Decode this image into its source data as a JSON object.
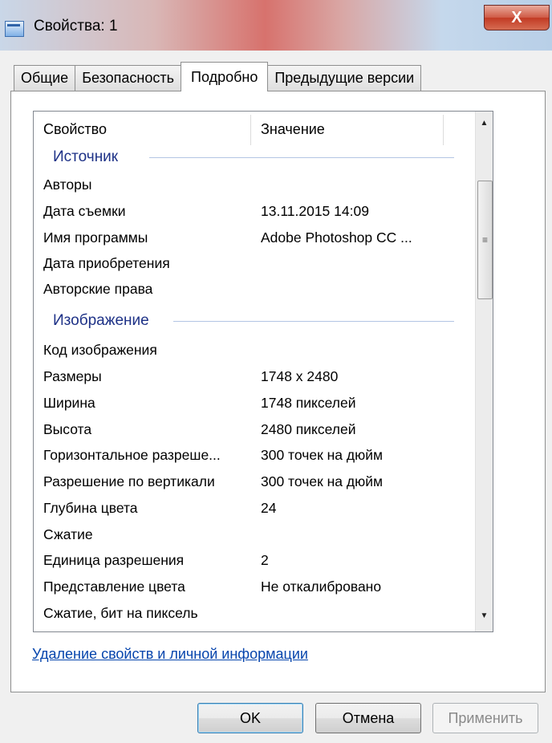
{
  "window": {
    "title": "Свойства: 1",
    "close_symbol": "X"
  },
  "tabs": [
    {
      "label": "Общие",
      "active": false
    },
    {
      "label": "Безопасность",
      "active": false
    },
    {
      "label": "Подробно",
      "active": true
    },
    {
      "label": "Предыдущие версии",
      "active": false
    }
  ],
  "grid": {
    "headers": {
      "property": "Свойство",
      "value": "Значение"
    },
    "groups": {
      "source": "Источник",
      "image": "Изображение"
    },
    "source_rows": [
      {
        "property": "Авторы",
        "value": ""
      },
      {
        "property": "Дата съемки",
        "value": "13.11.2015 14:09"
      },
      {
        "property": "Имя программы",
        "value": "Adobe Photoshop CC ..."
      },
      {
        "property": "Дата приобретения",
        "value": ""
      },
      {
        "property": "Авторские права",
        "value": ""
      }
    ],
    "image_rows": [
      {
        "property": "Код изображения",
        "value": ""
      },
      {
        "property": "Размеры",
        "value": "1748 x 2480"
      },
      {
        "property": "Ширина",
        "value": "1748 пикселей"
      },
      {
        "property": "Высота",
        "value": "2480 пикселей"
      },
      {
        "property": "Горизонтальное разреше...",
        "value": "300 точек на дюйм"
      },
      {
        "property": "Разрешение по вертикали",
        "value": "300 точек на дюйм"
      },
      {
        "property": "Глубина цвета",
        "value": "24"
      },
      {
        "property": "Сжатие",
        "value": ""
      },
      {
        "property": "Единица разрешения",
        "value": "2"
      },
      {
        "property": "Представление цвета",
        "value": "Не откалибровано"
      },
      {
        "property": "Сжатие, бит на пиксель",
        "value": ""
      }
    ]
  },
  "link": {
    "label": "Удаление свойств и личной информации"
  },
  "buttons": {
    "ok": "OK",
    "cancel": "Отмена",
    "apply": "Применить"
  }
}
